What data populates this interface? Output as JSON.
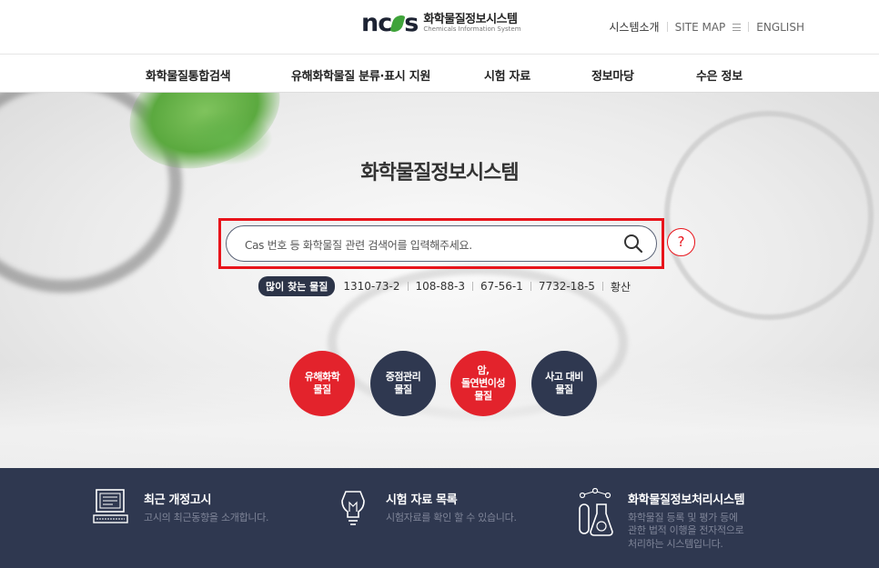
{
  "header": {
    "logo_mark": "ncis",
    "logo_title": "화학물질정보시스템",
    "logo_subtitle": "Chemicals Information System",
    "util": {
      "intro": "시스템소개",
      "sitemap": "SITE MAP",
      "english": "ENGLISH"
    }
  },
  "nav": {
    "items": [
      {
        "label": "화학물질통합검색"
      },
      {
        "label": "유해화학물질 분류·표시 지원"
      },
      {
        "label": "시험 자료"
      },
      {
        "label": "정보마당"
      },
      {
        "label": "수은 정보"
      }
    ]
  },
  "hero": {
    "title": "화학물질정보시스템",
    "search": {
      "placeholder": "Cas 번호 등 화학물질 관련 검색어를 입력해주세요.",
      "help": "?"
    },
    "popular": {
      "label": "많이 찾는 물질",
      "keywords": [
        "1310-73-2",
        "108-88-3",
        "67-56-1",
        "7732-18-5",
        "황산"
      ]
    },
    "categories": [
      {
        "line1": "유해화학",
        "line2": "물질",
        "line3": "",
        "color": "#e3232c"
      },
      {
        "line1": "중점관리",
        "line2": "물질",
        "line3": "",
        "color": "#2f3850"
      },
      {
        "line1": "암,",
        "line2": "돌연변이성",
        "line3": "물질",
        "color": "#e3232c"
      },
      {
        "line1": "사고 대비",
        "line2": "물질",
        "line3": "",
        "color": "#2f3850"
      }
    ]
  },
  "footer": {
    "items": [
      {
        "title": "최근 개정고시",
        "desc1": "고시의 최근동향을 소개합니다.",
        "desc2": "",
        "desc3": "",
        "icon": "computer-icon"
      },
      {
        "title": "시험 자료 목록",
        "desc1": "시험자료를 확인 할 수 있습니다.",
        "desc2": "",
        "desc3": "",
        "icon": "lightbulb-icon"
      },
      {
        "title": "화학물질정보처리시스템",
        "desc1": "화학물질 등록 및 평가 등에",
        "desc2": "관한 법적 이행을 전자적으로",
        "desc3": "처리하는 시스템입니다.",
        "icon": "flask-icon"
      }
    ]
  },
  "colors": {
    "accent_red": "#e3232c",
    "navy": "#2f3850",
    "highlight_box": "#e8141b"
  }
}
